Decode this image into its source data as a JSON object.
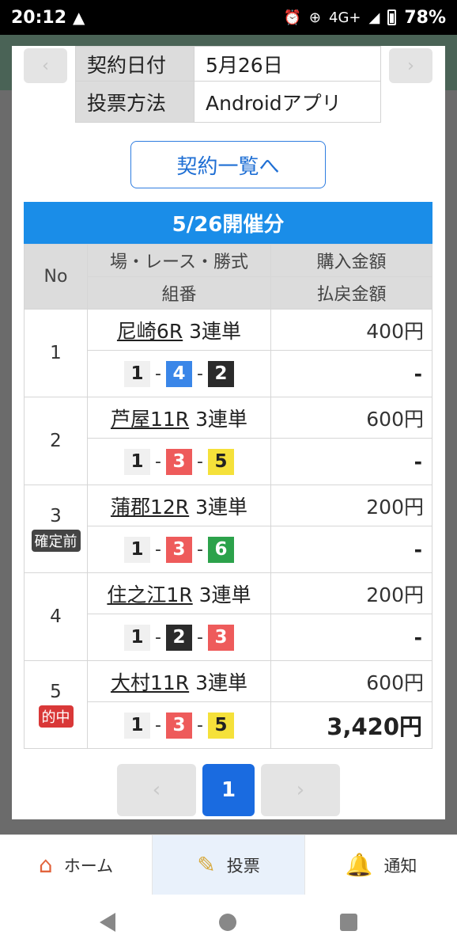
{
  "status_bar": {
    "time": "20:12",
    "warning_icon": "warning-icon",
    "network": "4G+",
    "battery": "78%"
  },
  "contract": {
    "rows": [
      {
        "label": "契約日付",
        "value": "5月26日"
      },
      {
        "label": "投票方法",
        "value": "Androidアプリ"
      }
    ],
    "list_button": "契約一覧へ"
  },
  "section_title": "5/26開催分",
  "table": {
    "headers": {
      "no": "No",
      "race_top": "場・レース・勝式",
      "race_bottom": "組番",
      "amount_top": "購入金額",
      "amount_bottom": "払戻金額"
    },
    "rows": [
      {
        "no": "1",
        "badge": "",
        "race": "尼崎6R",
        "type": "3連単",
        "combo": [
          "1",
          "4",
          "2"
        ],
        "combo_colors": [
          [
            "#f0f0f0",
            "#222"
          ],
          [
            "#3a86e8",
            "#fff"
          ],
          [
            "#2b2b2b",
            "#fff"
          ]
        ],
        "amount": "400円",
        "payout": "-"
      },
      {
        "no": "2",
        "badge": "",
        "race": "芦屋11R",
        "type": "3連単",
        "combo": [
          "1",
          "3",
          "5"
        ],
        "combo_colors": [
          [
            "#f0f0f0",
            "#222"
          ],
          [
            "#ee5b5b",
            "#fff"
          ],
          [
            "#f5e13a",
            "#222"
          ]
        ],
        "amount": "600円",
        "payout": "-"
      },
      {
        "no": "3",
        "badge": "確定前",
        "badge_type": "pending",
        "race": "蒲郡12R",
        "type": "3連単",
        "combo": [
          "1",
          "3",
          "6"
        ],
        "combo_colors": [
          [
            "#f0f0f0",
            "#222"
          ],
          [
            "#ee5b5b",
            "#fff"
          ],
          [
            "#2ca24b",
            "#fff"
          ]
        ],
        "amount": "200円",
        "payout": "-"
      },
      {
        "no": "4",
        "badge": "",
        "race": "住之江1R",
        "type": "3連単",
        "combo": [
          "1",
          "2",
          "3"
        ],
        "combo_colors": [
          [
            "#f0f0f0",
            "#222"
          ],
          [
            "#2b2b2b",
            "#fff"
          ],
          [
            "#ee5b5b",
            "#fff"
          ]
        ],
        "amount": "200円",
        "payout": "-"
      },
      {
        "no": "5",
        "badge": "的中",
        "badge_type": "hit",
        "race": "大村11R",
        "type": "3連単",
        "combo": [
          "1",
          "3",
          "5"
        ],
        "combo_colors": [
          [
            "#f0f0f0",
            "#222"
          ],
          [
            "#ee5b5b",
            "#fff"
          ],
          [
            "#f5e13a",
            "#222"
          ]
        ],
        "amount": "600円",
        "payout": "3,420円"
      }
    ]
  },
  "pagination": {
    "prev": "‹",
    "current": "1",
    "next": "›"
  },
  "tabs": [
    {
      "label": "ホーム",
      "icon": "home-icon"
    },
    {
      "label": "投票",
      "icon": "ticket-icon"
    },
    {
      "label": "通知",
      "icon": "bell-icon"
    }
  ],
  "colors": {
    "accent_blue": "#1a8de8",
    "page_active": "#1a6be0",
    "hit_badge": "#d93838"
  }
}
